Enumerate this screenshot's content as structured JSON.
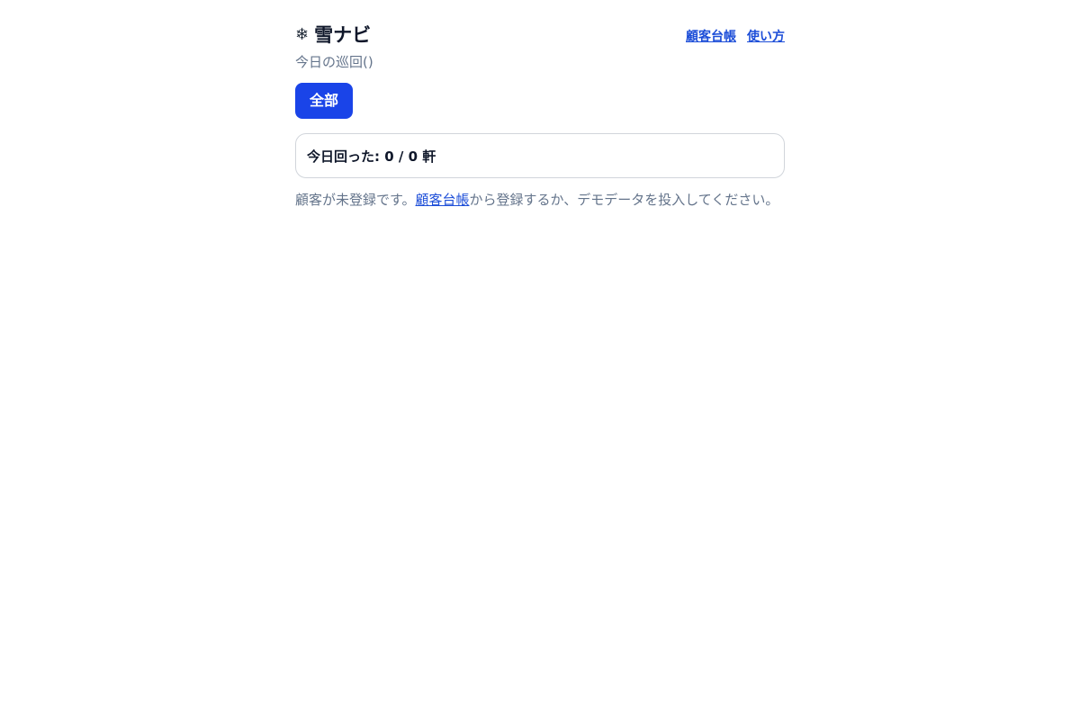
{
  "header": {
    "icon": "snowflake-icon",
    "icon_glyph": "❄",
    "title": "雪ナビ",
    "nav": [
      {
        "label": "顧客台帳"
      },
      {
        "label": "使い方"
      }
    ]
  },
  "subtitle": "今日の巡回()",
  "filters": {
    "active_label": "全部"
  },
  "progress": {
    "text": "今日回った: 0 / 0 軒"
  },
  "empty_message": {
    "before": "顧客が未登録です。",
    "link": "顧客台帳",
    "after": "から登録するか、デモデータを投入してください。"
  },
  "colors": {
    "accent": "#1a44e8",
    "link": "#1d4ed8",
    "muted": "#64748b"
  }
}
